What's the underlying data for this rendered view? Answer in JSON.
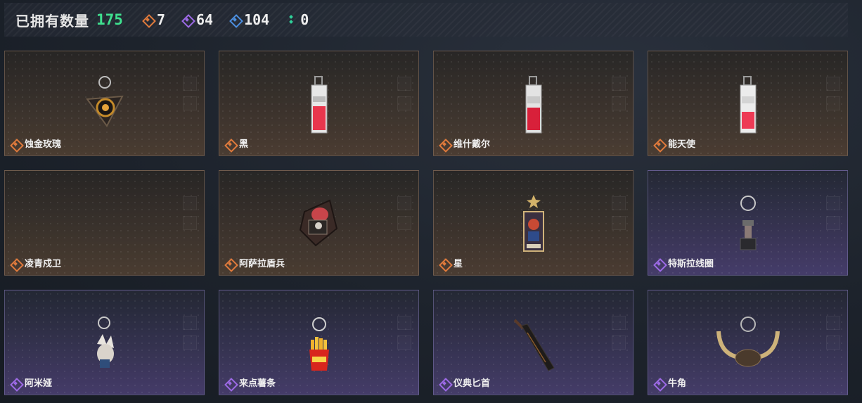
{
  "header": {
    "owned_label": "已拥有数量",
    "owned_count": "175",
    "stats": [
      {
        "icon": "orange-diamond-icon",
        "value": "7",
        "color": "#e07a3c"
      },
      {
        "icon": "purple-diamond-icon",
        "value": "64",
        "color": "#9d6ae6"
      },
      {
        "icon": "blue-diamond-icon",
        "value": "104",
        "color": "#4c8fe0"
      },
      {
        "icon": "green-dots-icon",
        "value": "0",
        "color": "#2fd19a"
      }
    ]
  },
  "cards": [
    {
      "name": "蚀金玫瑰",
      "rarity": "orange",
      "item": "rose-pendant-icon"
    },
    {
      "name": "黑",
      "rarity": "orange",
      "item": "tag-charm-icon"
    },
    {
      "name": "维什戴尔",
      "rarity": "orange",
      "item": "tag-charm-icon"
    },
    {
      "name": "能天使",
      "rarity": "orange",
      "item": "tag-charm-icon"
    },
    {
      "name": "凌青戍卫",
      "rarity": "orange",
      "item": ""
    },
    {
      "name": "阿萨拉盾兵",
      "rarity": "orange",
      "item": "shield-soldier-charm-icon"
    },
    {
      "name": "星",
      "rarity": "orange",
      "item": "star-card-charm-icon"
    },
    {
      "name": "特斯拉线圈",
      "rarity": "purple",
      "item": "tesla-coil-charm-icon"
    },
    {
      "name": "阿米娅",
      "rarity": "purple",
      "item": "amiya-charm-icon"
    },
    {
      "name": "来点薯条",
      "rarity": "purple",
      "item": "fries-charm-icon"
    },
    {
      "name": "仪典匕首",
      "rarity": "purple",
      "item": "dagger-charm-icon"
    },
    {
      "name": "牛角",
      "rarity": "purple",
      "item": "bull-horn-charm-icon"
    }
  ]
}
